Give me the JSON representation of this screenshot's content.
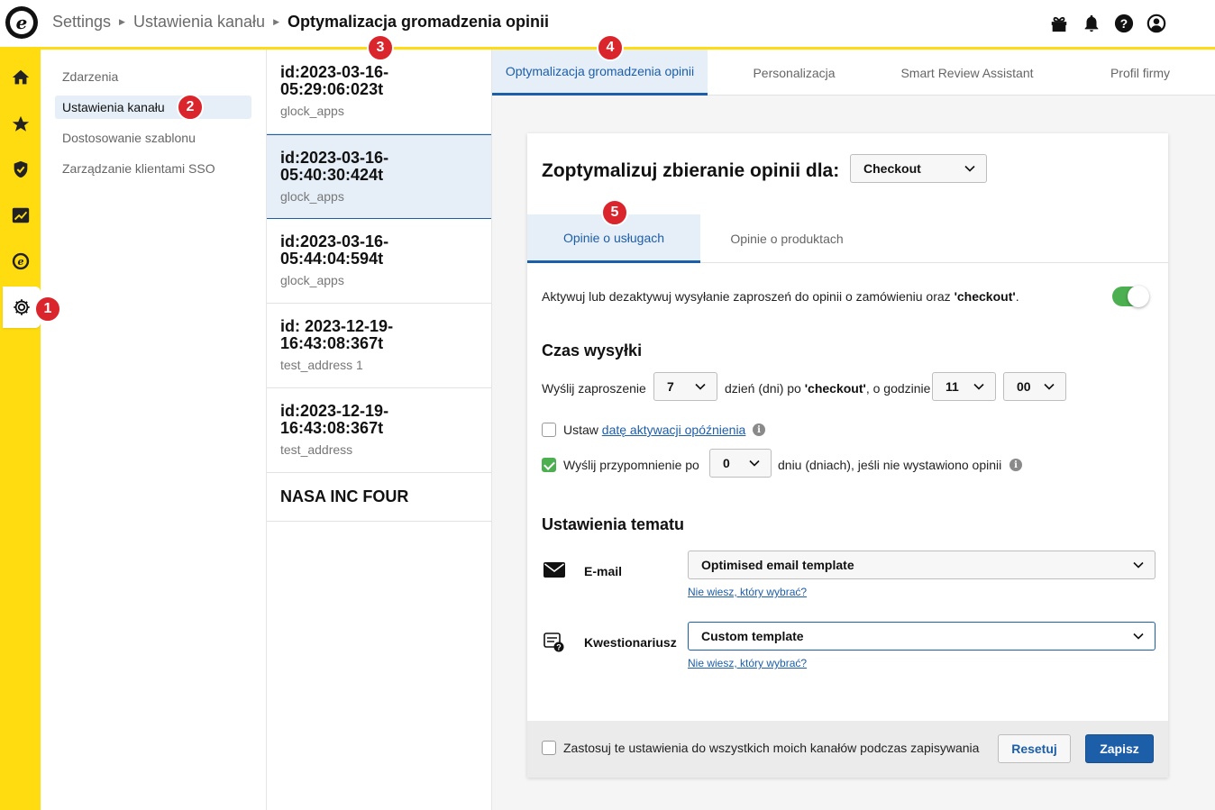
{
  "header": {
    "breadcrumb": [
      "Settings",
      "Ustawienia kanału",
      "Optymalizacja gromadzenia opinii"
    ],
    "icons": [
      "gift-icon",
      "bell-icon",
      "help-icon",
      "user-icon"
    ]
  },
  "rail": {
    "items": [
      "home-icon",
      "star-icon",
      "shield-icon",
      "chart-icon",
      "trustedshops-icon",
      "gear-icon"
    ],
    "active": "gear-icon"
  },
  "badges": [
    "1",
    "2",
    "3",
    "4",
    "5"
  ],
  "subnav": {
    "items": [
      {
        "label": "Zdarzenia"
      },
      {
        "label": "Ustawienia kanału"
      },
      {
        "label": "Dostosowanie szablonu"
      },
      {
        "label": "Zarządzanie klientami SSO"
      }
    ]
  },
  "channels": [
    {
      "title": "id:2023-03-16-05:29:06:023t",
      "sub": "glock_apps"
    },
    {
      "title": "id:2023-03-16-05:40:30:424t",
      "sub": "glock_apps"
    },
    {
      "title": "id:2023-03-16-05:44:04:594t",
      "sub": "glock_apps"
    },
    {
      "title": "id: 2023-12-19-16:43:08:367t",
      "sub": "test_address 1"
    },
    {
      "title": "id:2023-12-19-16:43:08:367t",
      "sub": "test_address"
    },
    {
      "title": "NASA INC FOUR",
      "sub": ""
    }
  ],
  "tabs": [
    "Optymalizacja gromadzenia opinii",
    "Personalizacja",
    "Smart Review Assistant",
    "Profil firmy"
  ],
  "card": {
    "title": "Zoptymalizuj zbieranie opinii dla:",
    "event_select": "Checkout",
    "inner_tabs": [
      "Opinie o usługach",
      "Opinie o produktach"
    ],
    "toggle_text_pre": "Aktywuj lub dezaktywuj wysyłanie zaproszeń do opinii o zamówieniu oraz ",
    "toggle_text_bold": "'checkout'",
    "toggle_text_post": ".",
    "send_time_heading": "Czas wysyłki",
    "send_prefix": "Wyślij zaproszenie",
    "send_days": "7",
    "send_mid_pre": "dzień (dni) po ",
    "send_mid_bold": "'checkout'",
    "send_mid_post": ", o godzinie",
    "send_hour": "11",
    "send_minute": "00",
    "delay_pre": "Ustaw ",
    "delay_link": "datę aktywacji opóźnienia",
    "reminder_label": "Wyślij przypomnienie po",
    "reminder_days": "0",
    "reminder_suffix": "dniu (dniach), jeśli nie wystawiono opinii",
    "theme_heading": "Ustawienia tematu",
    "email_label": "E-mail",
    "email_template": "Optimised email template",
    "help_link": "Nie wiesz, który wybrać?",
    "questionnaire_label": "Kwestionariusz",
    "questionnaire_template": "Custom template",
    "apply_all": "Zastosuj te ustawienia do wszystkich moich kanałów podczas zapisywania",
    "reset": "Resetuj",
    "save": "Zapisz"
  }
}
